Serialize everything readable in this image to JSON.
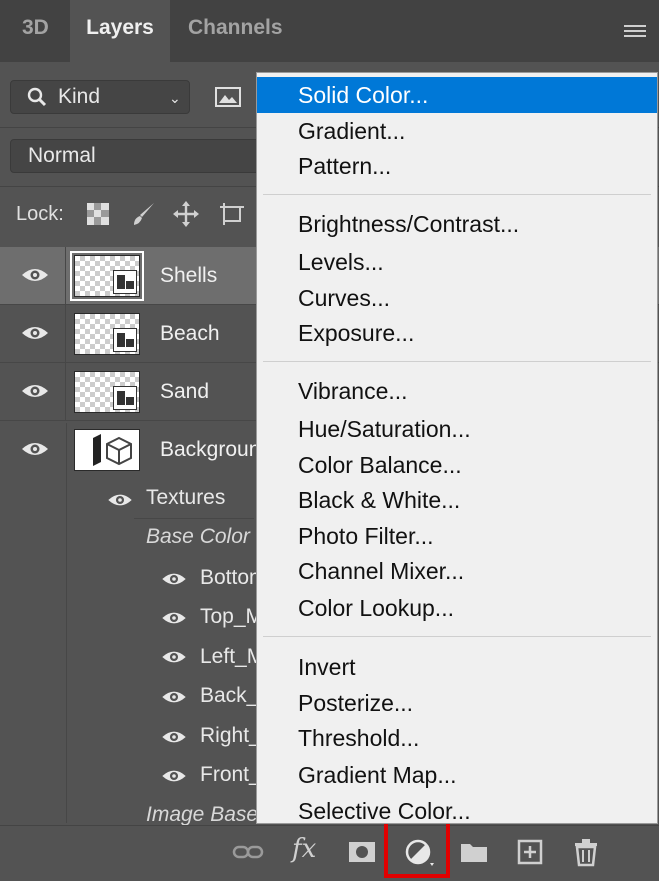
{
  "tabs": [
    {
      "label": "3D"
    },
    {
      "label": "Layers"
    },
    {
      "label": "Channels"
    }
  ],
  "filter": {
    "kind_label": "Kind"
  },
  "blend_mode": "Normal",
  "lock_label": "Lock:",
  "layers": [
    {
      "name": "Shells",
      "selected": true
    },
    {
      "name": "Beach"
    },
    {
      "name": "Sand"
    },
    {
      "name": "Background"
    }
  ],
  "sublayers": {
    "textures": "Textures",
    "base_color": "Base Color",
    "items": [
      "Bottom",
      "Top_M",
      "Left_M",
      "Back_",
      "Right_",
      "Front_"
    ],
    "image_based": "Image Base"
  },
  "toolbar": {
    "fx_label": "fx"
  },
  "menu": {
    "groups": [
      [
        "Solid Color...",
        "Gradient...",
        "Pattern..."
      ],
      [
        "Brightness/Contrast...",
        "Levels...",
        "Curves...",
        "Exposure..."
      ],
      [
        "Vibrance...",
        "Hue/Saturation...",
        "Color Balance...",
        "Black & White...",
        "Photo Filter...",
        "Channel Mixer...",
        "Color Lookup..."
      ],
      [
        "Invert",
        "Posterize...",
        "Threshold...",
        "Gradient Map...",
        "Selective Color..."
      ]
    ],
    "active_item": "Solid Color..."
  },
  "colors": {
    "panel_bg": "#535353",
    "menu_bg": "#f0f0f0",
    "menu_highlight": "#0078d7",
    "callout_red": "#e00000"
  },
  "icons": [
    "search-icon",
    "image-filter-icon",
    "panel-menu-icon",
    "lock-transparent-pixels-icon",
    "lock-image-pixels-icon",
    "lock-position-icon",
    "lock-artboard-icon",
    "eye-icon",
    "link-icon",
    "fx-icon",
    "mask-icon",
    "adjustment-layer-icon",
    "folder-icon",
    "new-layer-icon",
    "trash-icon"
  ]
}
